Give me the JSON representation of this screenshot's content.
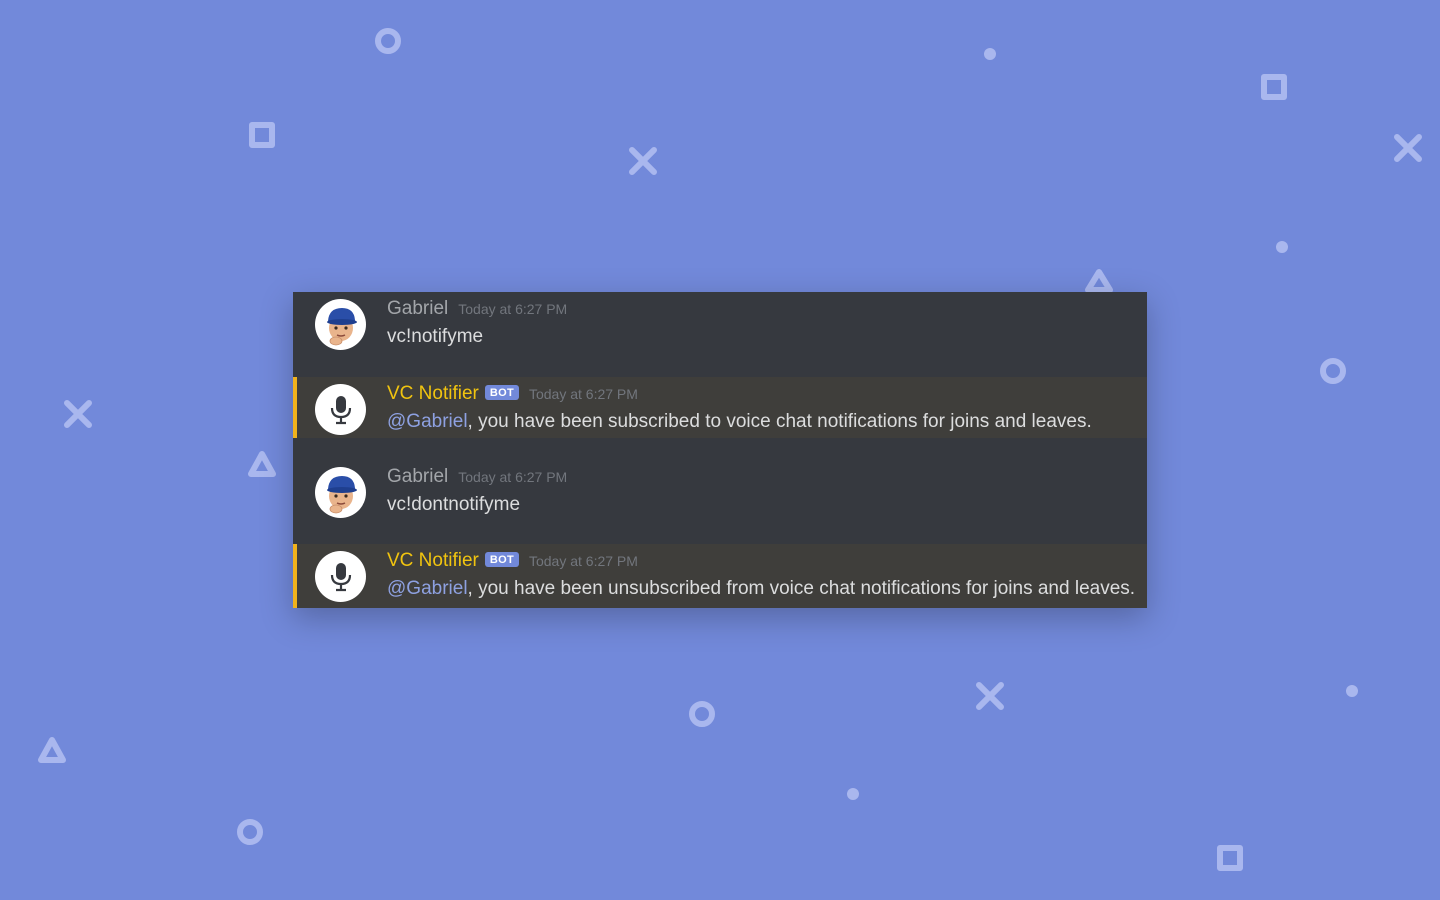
{
  "background": {
    "color": "#7289da"
  },
  "messages": [
    {
      "author": "Gabriel",
      "timestamp": "Today at 6:27 PM",
      "avatar_icon": "memoji-avatar",
      "text": "vc!notifyme"
    },
    {
      "author": "VC Notifier",
      "badge": "BOT",
      "timestamp": "Today at 6:27 PM",
      "avatar_icon": "microphone-icon",
      "mention": "@Gabriel",
      "text": ", you have been subscribed to voice chat notifications for joins and leaves."
    },
    {
      "author": "Gabriel",
      "timestamp": "Today at 6:27 PM",
      "avatar_icon": "memoji-avatar",
      "text": "vc!dontnotifyme"
    },
    {
      "author": "VC Notifier",
      "badge": "BOT",
      "timestamp": "Today at 6:27 PM",
      "avatar_icon": "microphone-icon",
      "mention": "@Gabriel",
      "text": ", you have been unsubscribed from voice chat notifications for joins and leaves."
    }
  ],
  "colors": {
    "chat_bg": "#36393f",
    "highlight_bg": "#3f3e3b",
    "mention_bar": "#f1b21c",
    "bot_name": "#f1c40f",
    "mention_text": "#8ea1e1",
    "badge_bg": "#7289da"
  }
}
